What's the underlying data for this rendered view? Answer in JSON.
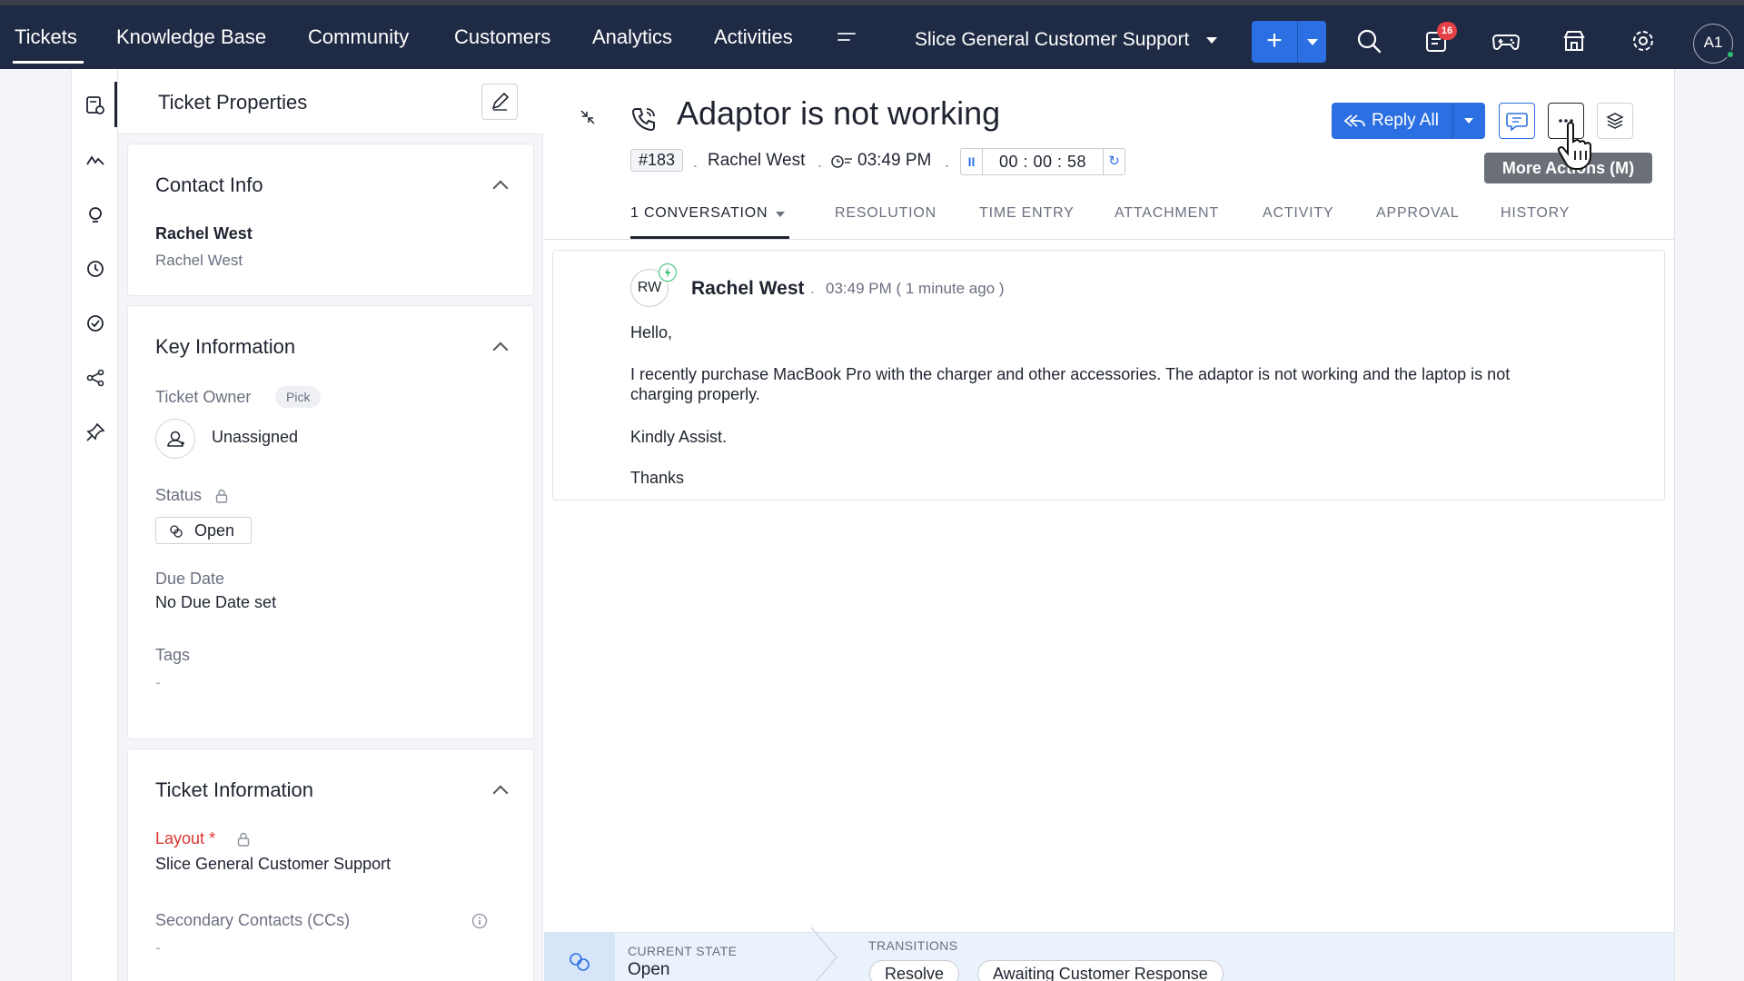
{
  "topnav": {
    "tabs": [
      "Tickets",
      "Knowledge Base",
      "Community",
      "Customers",
      "Analytics",
      "Activities"
    ],
    "department": "Slice General Customer Support",
    "notification_count": "16",
    "user_initials": "A1"
  },
  "props": {
    "title": "Ticket Properties",
    "contact": {
      "heading": "Contact Info",
      "name": "Rachel West",
      "sub": "Rachel West"
    },
    "key_info": {
      "heading": "Key Information",
      "owner_label": "Ticket Owner",
      "pick_label": "Pick",
      "owner_value": "Unassigned",
      "status_label": "Status",
      "status_value": "Open",
      "due_label": "Due Date",
      "due_value": "No Due Date set",
      "tags_label": "Tags",
      "tags_value": "-"
    },
    "ticket_info": {
      "heading": "Ticket Information",
      "layout_label": "Layout",
      "layout_required": "*",
      "layout_value": "Slice General Customer Support",
      "cc_label": "Secondary Contacts (CCs)",
      "cc_value": "-"
    }
  },
  "ticket": {
    "title": "Adaptor is not working",
    "id": "#183",
    "contact": "Rachel West",
    "time": "03:49 PM",
    "timer": "00 : 00 : 58",
    "reply_all": "Reply All",
    "tooltip": "More Actions (M)"
  },
  "tabs": [
    "1 CONVERSATION",
    "RESOLUTION",
    "TIME ENTRY",
    "ATTACHMENT",
    "ACTIVITY",
    "APPROVAL",
    "HISTORY"
  ],
  "message": {
    "initials": "RW",
    "author": "Rachel West",
    "time": "03:49 PM ( 1 minute ago )",
    "lines": [
      "Hello,",
      "I recently purchase MacBook Pro with the charger and other accessories. The adaptor is not working and the laptop is not",
      "charging properly.",
      "Kindly Assist.",
      "Thanks"
    ]
  },
  "state_bar": {
    "current_label": "CURRENT STATE",
    "current_value": "Open",
    "transitions_label": "TRANSITIONS",
    "transitions": [
      "Resolve",
      "Awaiting Customer Response"
    ]
  },
  "colors": {
    "nav_bg": "#1f2a44",
    "accent": "#2b6fe2",
    "required": "#d9362f",
    "online": "#2fbf71"
  }
}
